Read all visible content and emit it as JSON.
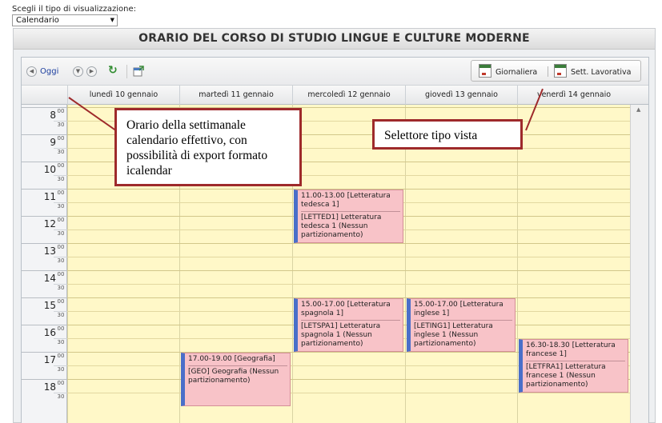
{
  "view_selector": {
    "label": "Scegli il tipo di visualizzazione:",
    "selected": "Calendario",
    "arrow": "▼"
  },
  "title": "ORARIO DEL CORSO DI STUDIO LINGUE E CULTURE MODERNE",
  "toolbar": {
    "prev_icon": "chevron-left-icon",
    "today_label": "Oggi",
    "next_icon": "chevron-right-icon",
    "refresh_icon": "refresh-icon",
    "export_icon": "export-ical-icon",
    "daily_label": "Giornaliera",
    "workweek_label": "Sett. Lavorativa"
  },
  "days": [
    "lunedì 10 gennaio",
    "martedì 11 gennaio",
    "mercoledì 12 gennaio",
    "giovedì 13 gennaio",
    "venerdì 14 gennaio"
  ],
  "hours": [
    "8",
    "9",
    "10",
    "11",
    "12",
    "13",
    "14",
    "15",
    "16",
    "17",
    "18"
  ],
  "minute_marks": [
    "00",
    "30"
  ],
  "events": [
    {
      "day": 2,
      "start": 11.0,
      "end": 13.0,
      "title": "11.00-13.00 [Letteratura tedesca 1]",
      "desc": "[LETTED1] Letteratura tedesca 1 (Nessun partizionamento)"
    },
    {
      "day": 2,
      "start": 15.0,
      "end": 17.0,
      "title": "15.00-17.00 [Letteratura spagnola 1]",
      "desc": "[LETSPA1] Letteratura spagnola 1 (Nessun partizionamento)"
    },
    {
      "day": 3,
      "start": 15.0,
      "end": 17.0,
      "title": "15.00-17.00 [Letteratura inglese 1]",
      "desc": "[LETING1] Letteratura inglese 1 (Nessun partizionamento)"
    },
    {
      "day": 4,
      "start": 16.5,
      "end": 18.5,
      "title": "16.30-18.30 [Letteratura francese 1]",
      "desc": "[LETFRA1] Letteratura francese 1 (Nessun partizionamento)"
    },
    {
      "day": 1,
      "start": 17.0,
      "end": 19.0,
      "title": "17.00-19.00 [Geografia]",
      "desc": "[GEO] Geografia (Nessun partizionamento)"
    }
  ],
  "annotations": {
    "calendar_note": "Orario della settimanale calendario effettivo, con possibilità di export formato icalendar",
    "view_note": "Selettore tipo vista"
  },
  "colors": {
    "grid_background": "#fff8c8",
    "event_background": "#f8c3c8",
    "event_accent": "#4a6fc9",
    "callout_border": "#9e2a2b"
  }
}
